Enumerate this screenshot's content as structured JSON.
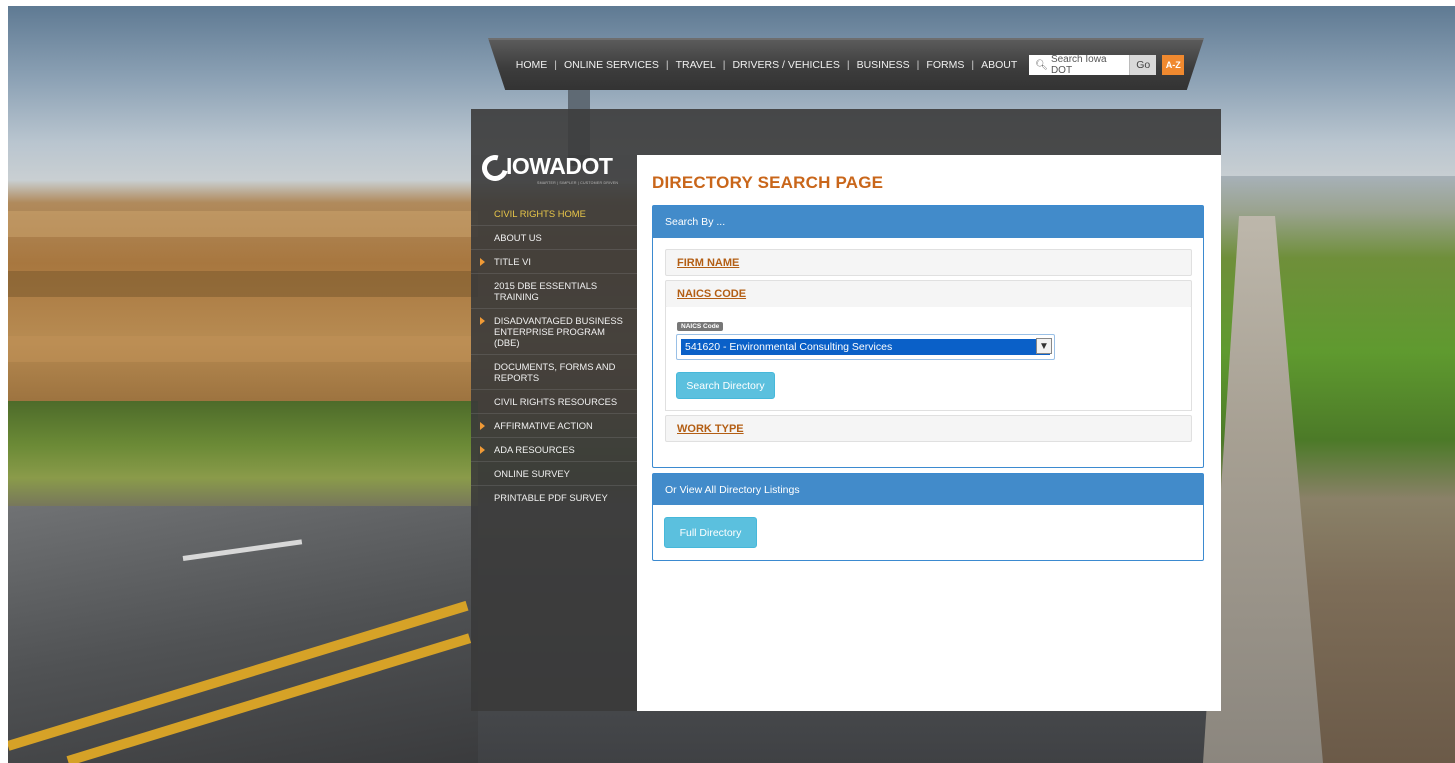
{
  "colors": {
    "brand_orange": "#c9661a",
    "panel_blue": "#428bca",
    "button_cyan": "#5bc0de",
    "active_nav": "#e8c649",
    "az_orange": "#f0892f"
  },
  "topnav": {
    "links": [
      "HOME",
      "ONLINE SERVICES",
      "TRAVEL",
      "DRIVERS / VEHICLES",
      "BUSINESS",
      "FORMS",
      "ABOUT"
    ],
    "separator": "|",
    "search_placeholder": "Search Iowa DOT",
    "search_icon": "search-icon",
    "go_label": "Go",
    "az_label": "A-Z"
  },
  "logo": {
    "wordmark": "IOWADOT",
    "tagline": "SMARTER | SIMPLER | CUSTOMER DRIVEN"
  },
  "sidebar": {
    "items": [
      {
        "label": "CIVIL RIGHTS HOME",
        "active": true,
        "arrow": false
      },
      {
        "label": "ABOUT US",
        "active": false,
        "arrow": false
      },
      {
        "label": "TITLE VI",
        "active": false,
        "arrow": true
      },
      {
        "label": "2015 DBE ESSENTIALS TRAINING",
        "active": false,
        "arrow": false
      },
      {
        "label": "DISADVANTAGED BUSINESS ENTERPRISE PROGRAM (DBE)",
        "active": false,
        "arrow": true
      },
      {
        "label": "DOCUMENTS, FORMS AND REPORTS",
        "active": false,
        "arrow": false
      },
      {
        "label": "CIVIL RIGHTS RESOURCES",
        "active": false,
        "arrow": false
      },
      {
        "label": "AFFIRMATIVE ACTION",
        "active": false,
        "arrow": true
      },
      {
        "label": "ADA RESOURCES",
        "active": false,
        "arrow": true
      },
      {
        "label": "ONLINE SURVEY",
        "active": false,
        "arrow": false
      },
      {
        "label": "PRINTABLE PDF SURVEY",
        "active": false,
        "arrow": false
      }
    ]
  },
  "main": {
    "title": "DIRECTORY SEARCH PAGE",
    "search_panel": {
      "heading": "Search By ...",
      "sections": {
        "firm_name": "FIRM NAME",
        "naics_code": "NAICS CODE",
        "work_type": "WORK TYPE"
      },
      "naics_label": "NAICS Code",
      "naics_selected": "541620 - Environmental Consulting Services",
      "search_button": "Search Directory"
    },
    "all_panel": {
      "heading": "Or View All Directory Listings",
      "full_button": "Full Directory"
    }
  }
}
